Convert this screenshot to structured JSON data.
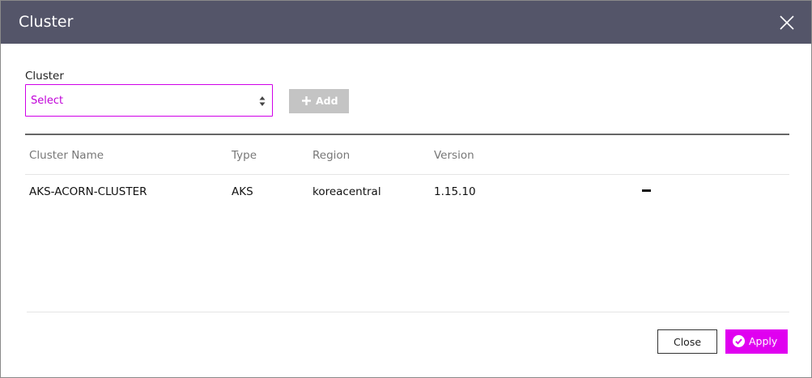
{
  "dialog": {
    "title": "Cluster",
    "header_color": "#545569"
  },
  "form": {
    "cluster_label": "Cluster",
    "select_value": "Select",
    "add_label": "Add",
    "accent_color": "#e000f0"
  },
  "table": {
    "columns": [
      "Cluster Name",
      "Type",
      "Region",
      "Version"
    ],
    "rows": [
      {
        "name": "AKS-ACORN-CLUSTER",
        "type": "AKS",
        "region": "koreacentral",
        "version": "1.15.10"
      }
    ]
  },
  "footer": {
    "close_label": "Close",
    "apply_label": "Apply"
  },
  "icons": {
    "close": "close-icon",
    "select_arrows": "sort-arrows-icon",
    "add": "plus-icon",
    "remove": "minus-icon",
    "apply": "check-circle-icon"
  }
}
